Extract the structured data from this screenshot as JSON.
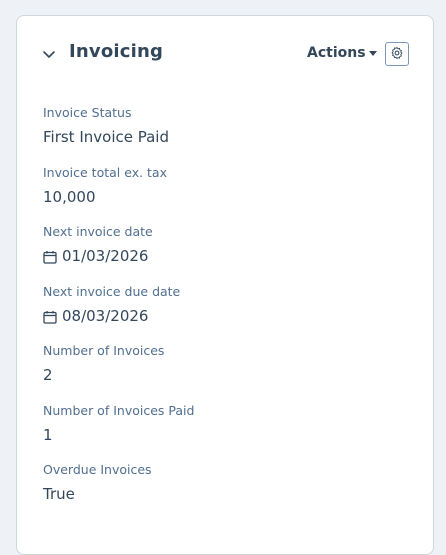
{
  "card": {
    "title": "Invoicing",
    "actions_label": "Actions",
    "icons": {
      "collapse": "chevron-down-icon",
      "actions_caret": "caret-down-icon",
      "settings": "gear-icon",
      "date": "calendar-icon"
    }
  },
  "properties": [
    {
      "label": "Invoice Status",
      "value": "First Invoice Paid"
    },
    {
      "label": "Invoice total ex. tax",
      "value": "10,000"
    },
    {
      "label": "Next invoice date",
      "value": "01/03/2026"
    },
    {
      "label": "Next invoice due date",
      "value": "08/03/2026"
    },
    {
      "label": "Number of Invoices",
      "value": "2"
    },
    {
      "label": "Number of Invoices Paid",
      "value": "1"
    },
    {
      "label": "Overdue Invoices",
      "value": "True"
    }
  ],
  "colors": {
    "text": "#33475b",
    "label": "#516f90",
    "border": "#cfd6de",
    "background": "#eef2f6"
  }
}
